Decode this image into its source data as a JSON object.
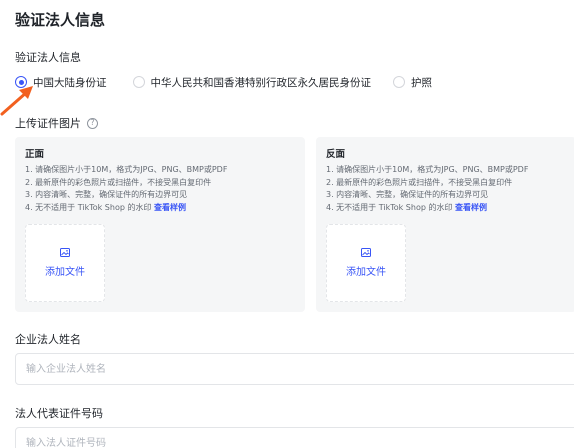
{
  "page": {
    "title": "验证法人信息"
  },
  "id_type": {
    "label": "验证法人信息",
    "options": [
      {
        "label": "中国大陆身份证",
        "selected": true
      },
      {
        "label": "中华人民共和国香港特别行政区永久居民身份证",
        "selected": false
      },
      {
        "label": "护照",
        "selected": false
      }
    ]
  },
  "upload": {
    "title": "上传证件图片",
    "help_icon": "question-circle-icon",
    "front": {
      "title": "正面",
      "rules": [
        "1. 请确保图片小于10M，格式为JPG、PNG、BMP或PDF",
        "2. 最新原件的彩色照片或扫描件，不接受黑白复印件",
        "3. 内容清晰、完整，确保证件的所有边界可见",
        "4. 无不适用于 TikTok Shop 的水印"
      ],
      "link": "查看样例",
      "add_label": "添加文件"
    },
    "back": {
      "title": "反面",
      "rules": [
        "1. 请确保图片小于10M，格式为JPG、PNG、BMP或PDF",
        "2. 最新原件的彩色照片或扫描件，不接受黑白复印件",
        "3. 内容清晰、完整，确保证件的所有边界可见",
        "4. 无不适用于 TikTok Shop 的水印"
      ],
      "link": "查看样例",
      "add_label": "添加文件"
    }
  },
  "legal_name": {
    "label": "企业法人姓名",
    "placeholder": "输入企业法人姓名",
    "value": ""
  },
  "legal_id": {
    "label": "法人代表证件号码",
    "placeholder": "输入法人证件号码",
    "value": ""
  },
  "colors": {
    "accent": "#3955f6",
    "annotation_arrow": "#f2601f",
    "card_bg": "#f5f6f7"
  }
}
